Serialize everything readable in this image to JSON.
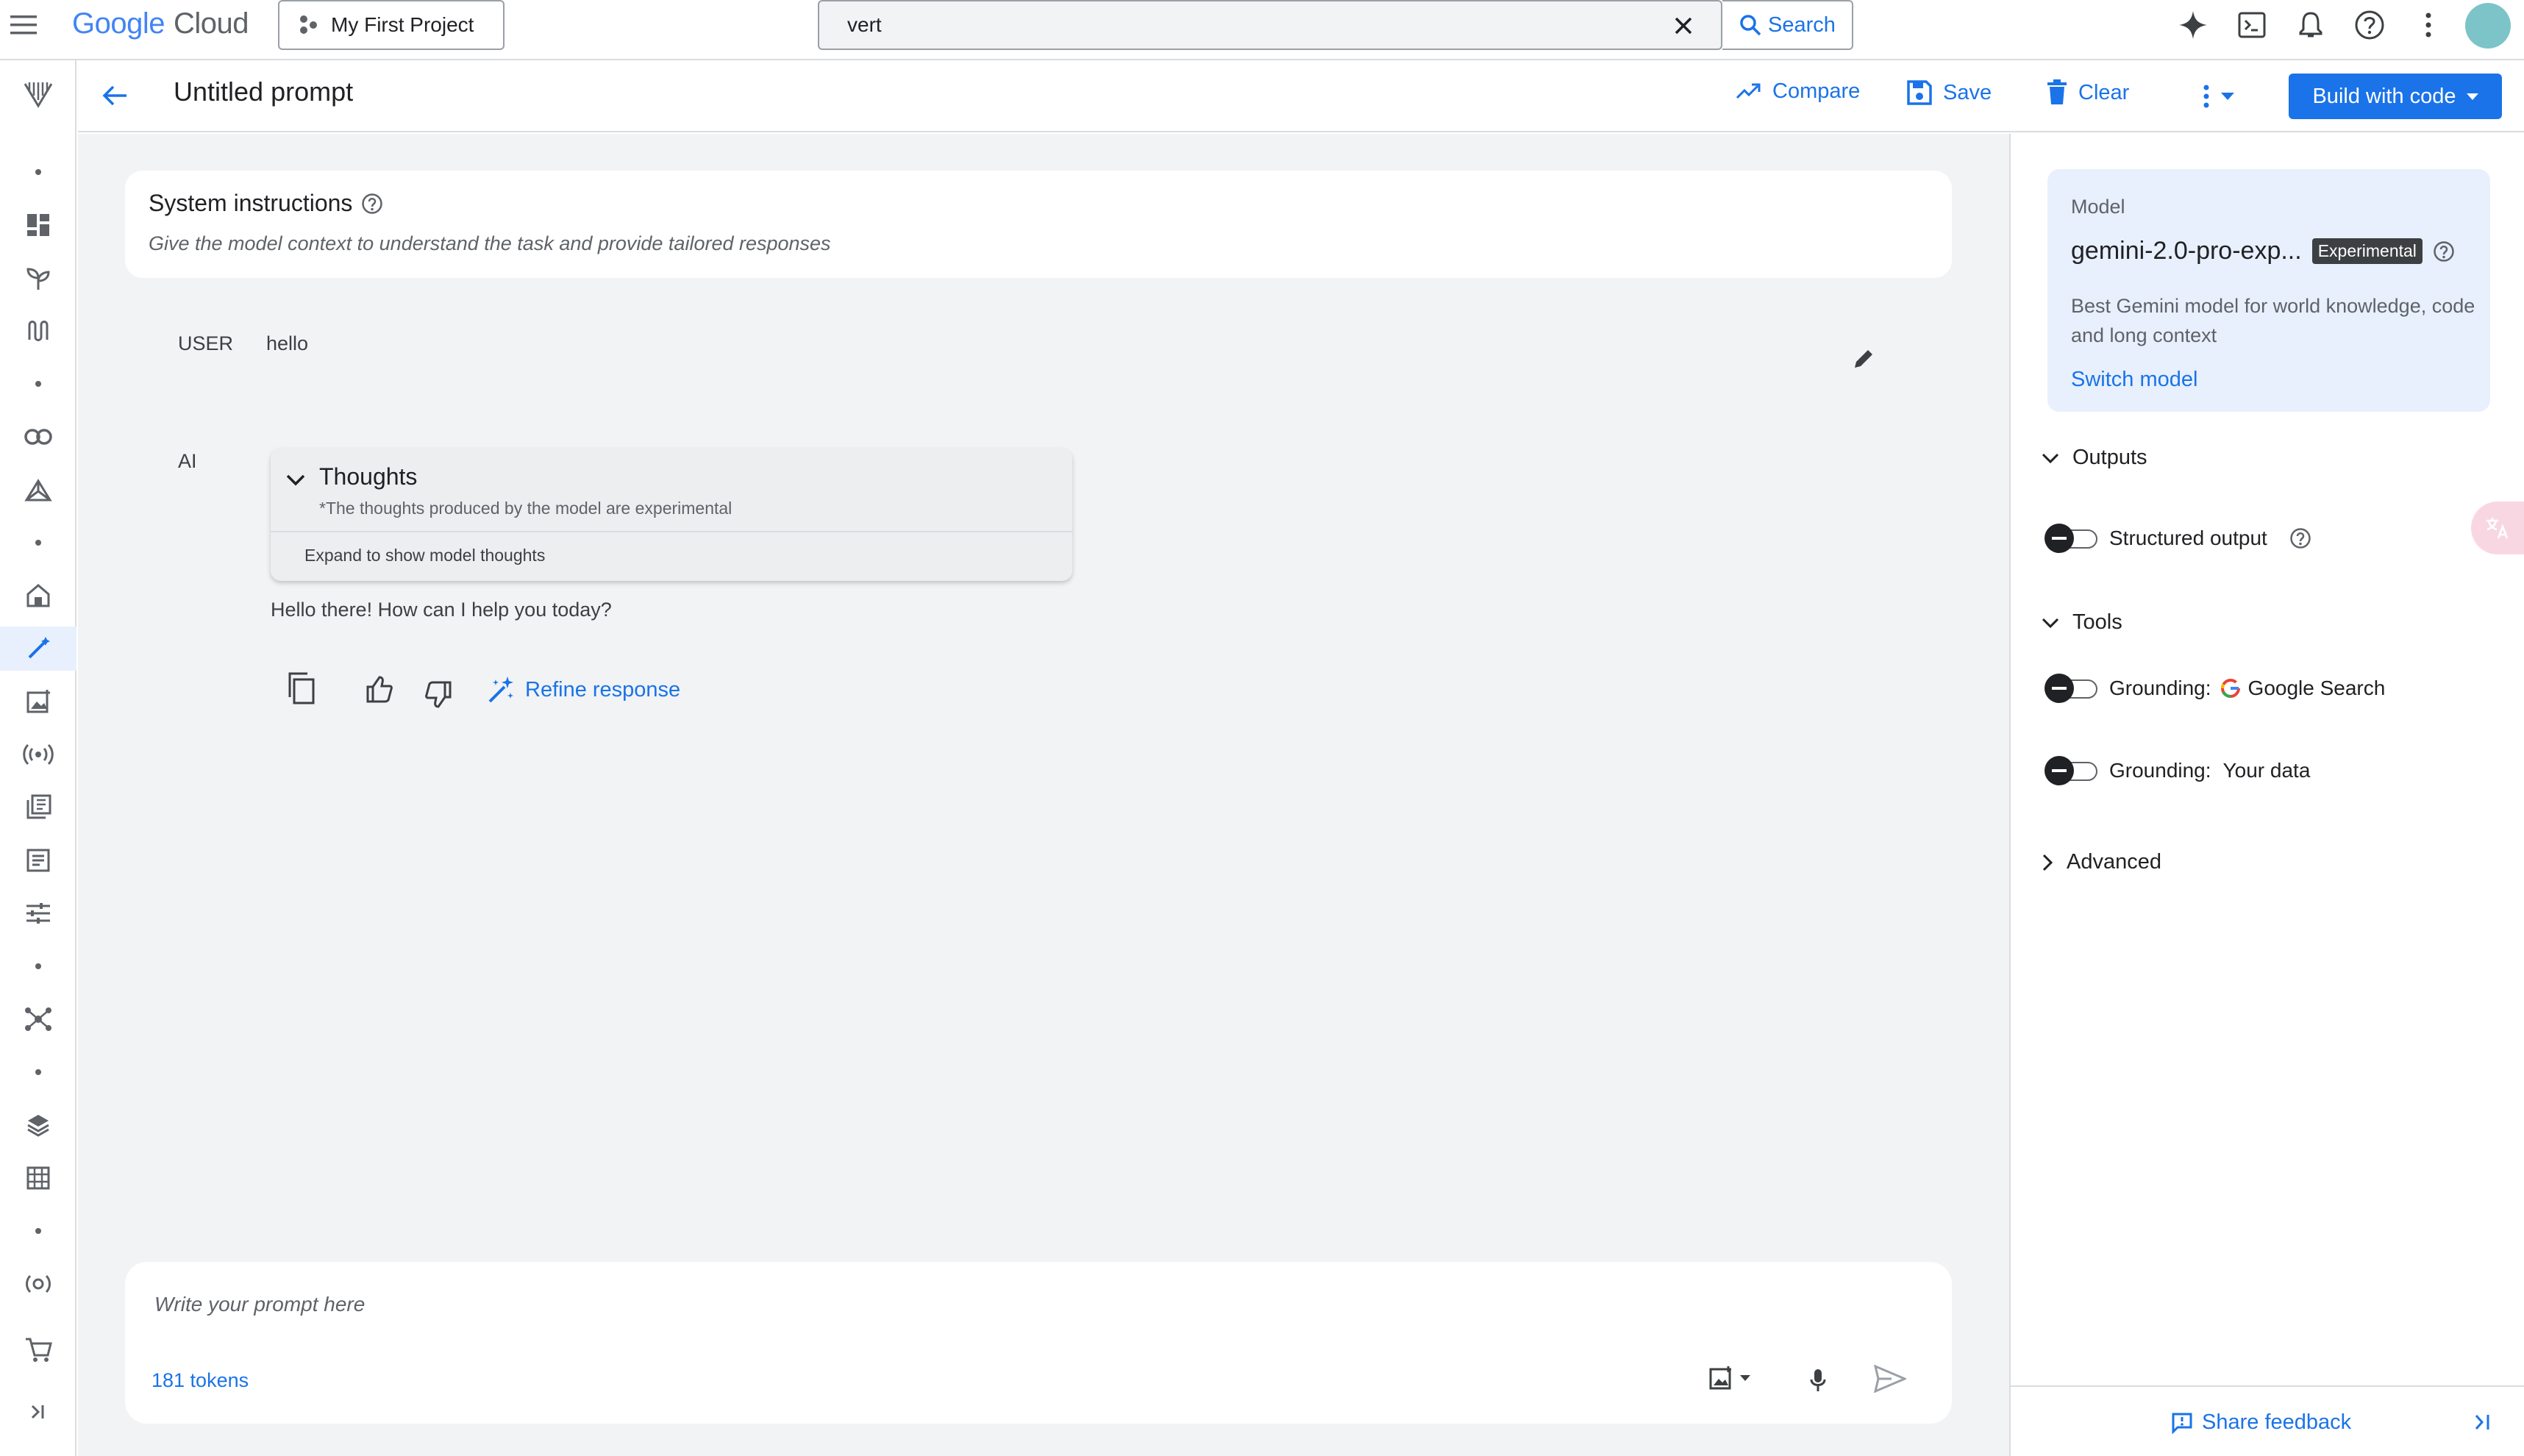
{
  "topbar": {
    "logo_google": "Google",
    "logo_cloud": "Cloud",
    "project": "My First Project",
    "search_value": "vert",
    "search_button": "Search"
  },
  "header": {
    "title": "Untitled prompt",
    "compare": "Compare",
    "save": "Save",
    "clear": "Clear",
    "build": "Build with code"
  },
  "system": {
    "title": "System instructions",
    "placeholder": "Give the model context to understand the task and provide tailored responses"
  },
  "conversation": {
    "user_role": "USER",
    "user_message": "hello",
    "ai_role": "AI",
    "thoughts_title": "Thoughts",
    "thoughts_note": "*The thoughts produced by the model are experimental",
    "thoughts_expand": "Expand to show model thoughts",
    "ai_message": "Hello there! How can I help you today?",
    "refine": "Refine response"
  },
  "prompt": {
    "placeholder": "Write your prompt here",
    "tokens": "181 tokens"
  },
  "panel": {
    "model_label": "Model",
    "model_name": "gemini-2.0-pro-exp...",
    "model_badge": "Experimental",
    "model_desc": "Best Gemini model for world knowledge, code and long context",
    "switch_model": "Switch model",
    "outputs": "Outputs",
    "structured_output": "Structured output",
    "tools": "Tools",
    "grounding_label_1": "Grounding:",
    "grounding_value_1": "Google Search",
    "grounding_label_2": "Grounding:",
    "grounding_value_2": "Your data",
    "advanced": "Advanced",
    "feedback": "Share feedback"
  },
  "colors": {
    "accent": "#1a73e8",
    "canvas": "#f1f3f4",
    "model_card": "#e8f0fe"
  }
}
